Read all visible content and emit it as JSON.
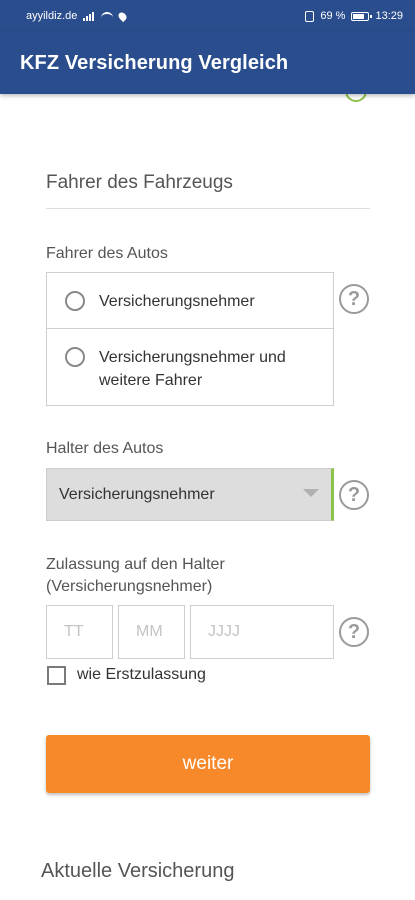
{
  "status_bar": {
    "carrier": "ayyildiz.de",
    "battery": "69 %",
    "time": "13:29"
  },
  "app_bar": {
    "title": "KFZ Versicherung Vergleich"
  },
  "section": {
    "title": "Fahrer des Fahrzeugs"
  },
  "driver": {
    "label": "Fahrer des Autos",
    "options": [
      {
        "label": "Versicherungsnehmer",
        "selected": false
      },
      {
        "label_line1": "Versicherungsnehmer und",
        "label_line2": "weitere Fahrer",
        "selected": false
      }
    ],
    "help": "?"
  },
  "holder": {
    "label": "Halter des Autos",
    "selected": "Versicherungsnehmer",
    "help": "?"
  },
  "registration": {
    "label_line1": "Zulassung auf den Halter",
    "label_line2": "(Versicherungsnehmer)",
    "day_placeholder": "TT",
    "month_placeholder": "MM",
    "year_placeholder": "JJJJ",
    "help": "?",
    "same_as_first_registration_label": "wie Erstzulassung",
    "same_as_first_registration_checked": false
  },
  "continue_button": "weiter",
  "next_section": {
    "title": "Aktuelle Versicherung"
  },
  "colors": {
    "primary": "#2a4d8d",
    "accent": "#f7892b",
    "success": "#8bc34a"
  }
}
